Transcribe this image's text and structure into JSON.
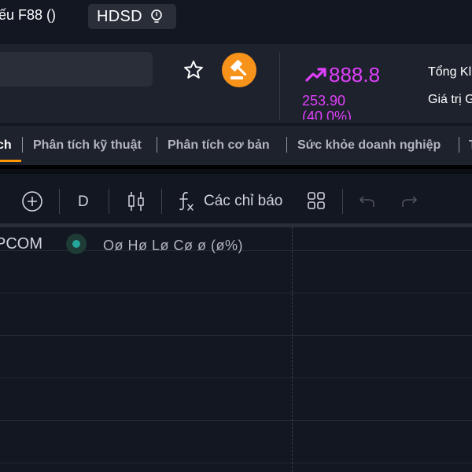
{
  "header": {
    "code_title": "iếu F88 ()",
    "guide_label": "HDSD",
    "guide_icon": "lightbulb-icon"
  },
  "quote": {
    "price": "888.8",
    "change": "253.90",
    "change_pct": "(40.0%)",
    "trend_icon": "trending-up-icon",
    "accent_color": "#e040fb",
    "total_label": "Tổng Kl",
    "value_label": "Giá trị G"
  },
  "actions": {
    "favorite_icon": "star-icon",
    "auction_icon": "auction-gavel-icon",
    "auction_color": "#f7931a"
  },
  "tabs": [
    {
      "label": "ch",
      "active": true
    },
    {
      "label": "Phân tích kỹ thuật"
    },
    {
      "label": "Phân tích cơ bản"
    },
    {
      "label": "Sức khỏe doanh nghiệp"
    },
    {
      "label": "T"
    }
  ],
  "active_tab_color": "#ff9800",
  "toolbar": {
    "add_icon": "plus-circle-icon",
    "interval": "D",
    "chart_type_icon": "candlestick-icon",
    "indicator_icon": "fx-icon",
    "indicators_label": "Các chỉ báo",
    "layout_icon": "grid-layout-icon",
    "undo_icon": "undo-icon",
    "redo_icon": "redo-icon"
  },
  "legend": {
    "symbol": "PCOM",
    "status_color": "#26a69a",
    "ohlc": "Oø Hø Lø Cø ø (ø%)"
  }
}
